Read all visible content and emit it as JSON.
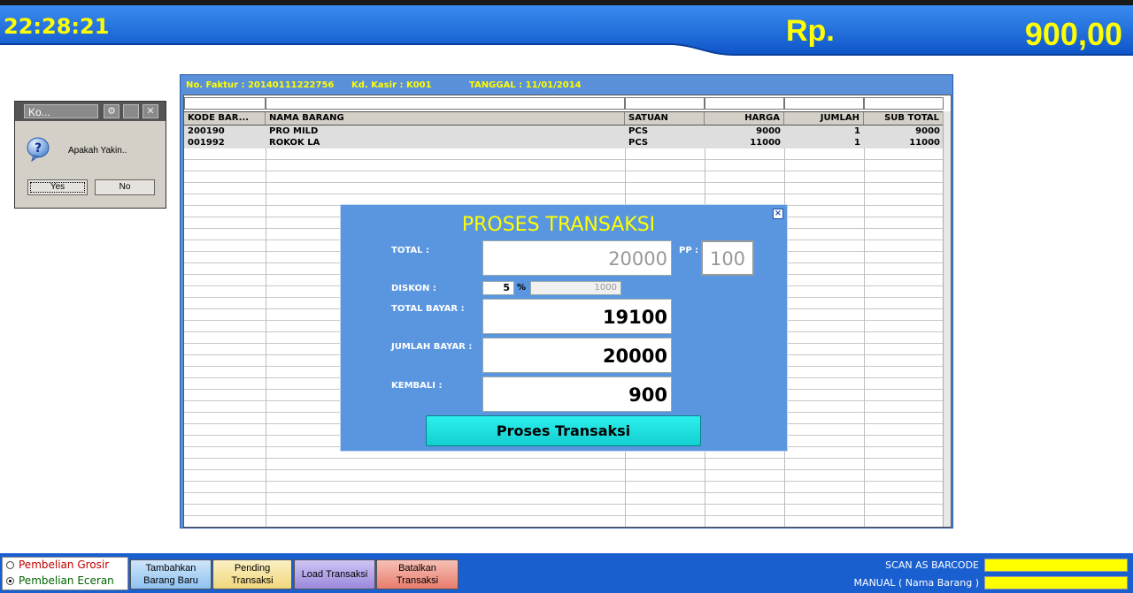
{
  "header": {
    "clock": "22:28:21",
    "currency": "Rp.",
    "total_display": "900,00"
  },
  "confirm_dialog": {
    "title": "Ko...",
    "message": "Apakah Yakin..",
    "yes_label": "Yes",
    "no_label": "No"
  },
  "info": {
    "faktur": "No. Faktur : 20140111222756",
    "kasir": "Kd. Kasir : K001",
    "tanggal": "TANGGAL : 11/01/2014"
  },
  "table": {
    "columns": [
      "KODE BAR...",
      "NAMA BARANG",
      "SATUAN",
      "HARGA",
      "JUMLAH",
      "SUB TOTAL"
    ],
    "rows": [
      [
        "200190",
        "PRO MILD",
        "PCS",
        "9000",
        "1",
        "9000"
      ],
      [
        "001992",
        "ROKOK LA",
        "PCS",
        "11000",
        "1",
        "11000"
      ]
    ]
  },
  "proses": {
    "title": "PROSES TRANSAKSI",
    "close_icon": "close-icon",
    "total_label": "TOTAL :",
    "total_value": "20000",
    "pp_label": "PP :",
    "pp_value": "100",
    "diskon_label": "DISKON :",
    "diskon_percent": "5",
    "percent_sign": "%",
    "diskon_value": "1000",
    "total_bayar_label": "TOTAL BAYAR :",
    "total_bayar_value": "19100",
    "jumlah_bayar_label": "JUMLAH BAYAR :",
    "jumlah_bayar_value": "20000",
    "kembali_label": "KEMBALI :",
    "kembali_value": "900",
    "button_label": "Proses Transaksi"
  },
  "footer": {
    "radio_grosir": "Pembelian Grosir",
    "radio_eceran": "Pembelian Eceran",
    "selected": "Pembelian Eceran",
    "btn_tambah_1": "Tambahkan",
    "btn_tambah_2": "Barang Baru",
    "btn_pending_1": "Pending",
    "btn_pending_2": "Transaksi",
    "btn_load": "Load Transaksi",
    "btn_batal_1": "Batalkan",
    "btn_batal_2": "Transaksi",
    "scan_label": "SCAN AS BARCODE",
    "manual_label": "MANUAL ( Nama Barang )"
  },
  "colors": {
    "header_blue": "#1a6fe0",
    "highlight_yellow": "#ffff00",
    "dialog_blue": "#5a96e0",
    "button_cyan": "#14cfd0",
    "btn_tambah": "#a9d0f5",
    "btn_pending": "#f5e6a0",
    "btn_load": "#b3a3e6",
    "btn_batal": "#ef9a8a"
  }
}
